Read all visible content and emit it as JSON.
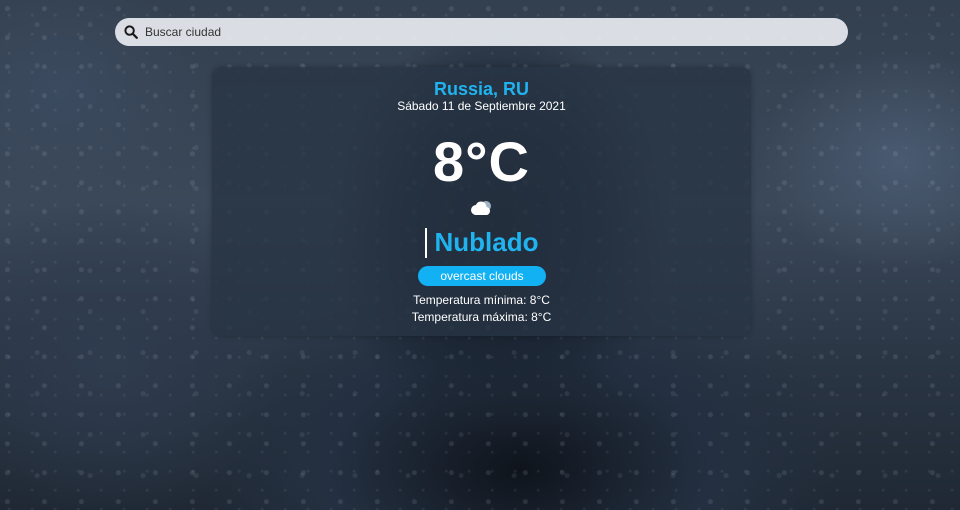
{
  "search": {
    "placeholder": "Buscar ciudad",
    "value": ""
  },
  "icons": {
    "search": "search-icon",
    "weather": "cloud-icon"
  },
  "weather": {
    "location": "Russia, RU",
    "date": "Sábado 11 de Septiembre 2021",
    "temperature": "8°C",
    "condition": "Nublado",
    "description": "overcast clouds",
    "min_temp": "Temperatura mínima: 8°C",
    "max_temp": "Temperatura máxima: 8°C"
  },
  "colors": {
    "accent": "#1fb3f0",
    "pill": "#12b1f3",
    "card": "#283444"
  }
}
